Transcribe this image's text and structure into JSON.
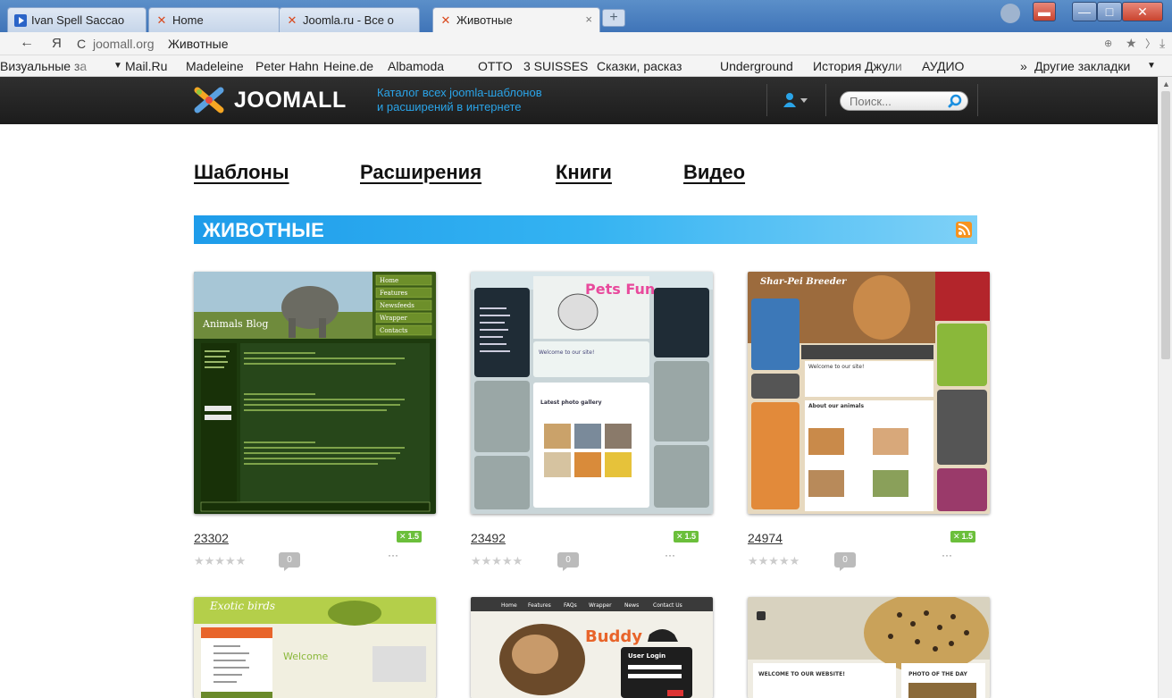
{
  "browser": {
    "tabs": [
      {
        "label": "Ivan Spell Saccao",
        "icon": "video-icon"
      },
      {
        "label": "Home",
        "icon": "joomla-icon"
      },
      {
        "label": "Joomla.ru - Все о",
        "icon": "joomla-icon"
      },
      {
        "label": "Животные",
        "icon": "joomla-icon",
        "active": true
      }
    ],
    "new_tab": "+",
    "address": {
      "back": "←",
      "yandex": "Я",
      "reload": "C",
      "host": "joomall.org",
      "title": "Животные",
      "bookmark_star": "★",
      "download": "⤓"
    },
    "bookmarks": [
      "Визуальные за",
      "Mail.Ru",
      "Madeleine",
      "Peter Hahn",
      "Heine.de",
      "Albamoda",
      "OTTO",
      "3 SUISSES",
      "Сказки, расказ",
      "Underground",
      "История Джули",
      "АУДИО",
      "Другие закладки"
    ],
    "bookmarks_more": "»"
  },
  "site": {
    "logo": "JOOMALL",
    "tagline_line1": "Каталог всех joomla-шаблонов",
    "tagline_line2": "и расширений в интернете",
    "search_placeholder": "Поиск...",
    "nav": [
      "Шаблоны",
      "Расширения",
      "Книги",
      "Видео"
    ],
    "category_title": "ЖИВОТНЫЕ",
    "cards": [
      {
        "id": "23302",
        "badge": "1.5",
        "thumb_title": "Animals Blog",
        "menu": [
          "Home",
          "Features",
          "Newsfeeds",
          "Wrapper",
          "Contacts"
        ]
      },
      {
        "id": "23492",
        "badge": "1.5",
        "thumb_title": "Pets Fun",
        "gallery": "Latest photo gallery",
        "welcome": "Welcome to our site!"
      },
      {
        "id": "24974",
        "badge": "1.5",
        "thumb_title": "Shar-Pei Breeder",
        "welcome": "Welcome to our site!",
        "section": "About our animals"
      }
    ],
    "row2_thumbs": [
      {
        "thumb_title": "Exotic birds",
        "welcome": "Welcome"
      },
      {
        "thumb_title": "Buddy",
        "menu": [
          "Home",
          "Features",
          "FAQs",
          "Wrapper",
          "News",
          "Contact Us"
        ],
        "login": "User Login"
      },
      {
        "welcome": "WELCOME TO OUR WEBSITE!",
        "photo": "PHOTO OF THE DAY"
      }
    ],
    "stars": "★★★★★",
    "comments": "0",
    "more": "···"
  },
  "colors": {
    "header_bg": "#222222",
    "accent_blue": "#1e9cea",
    "badge_green": "#6bbf3b",
    "rss_orange": "#f7931e"
  }
}
